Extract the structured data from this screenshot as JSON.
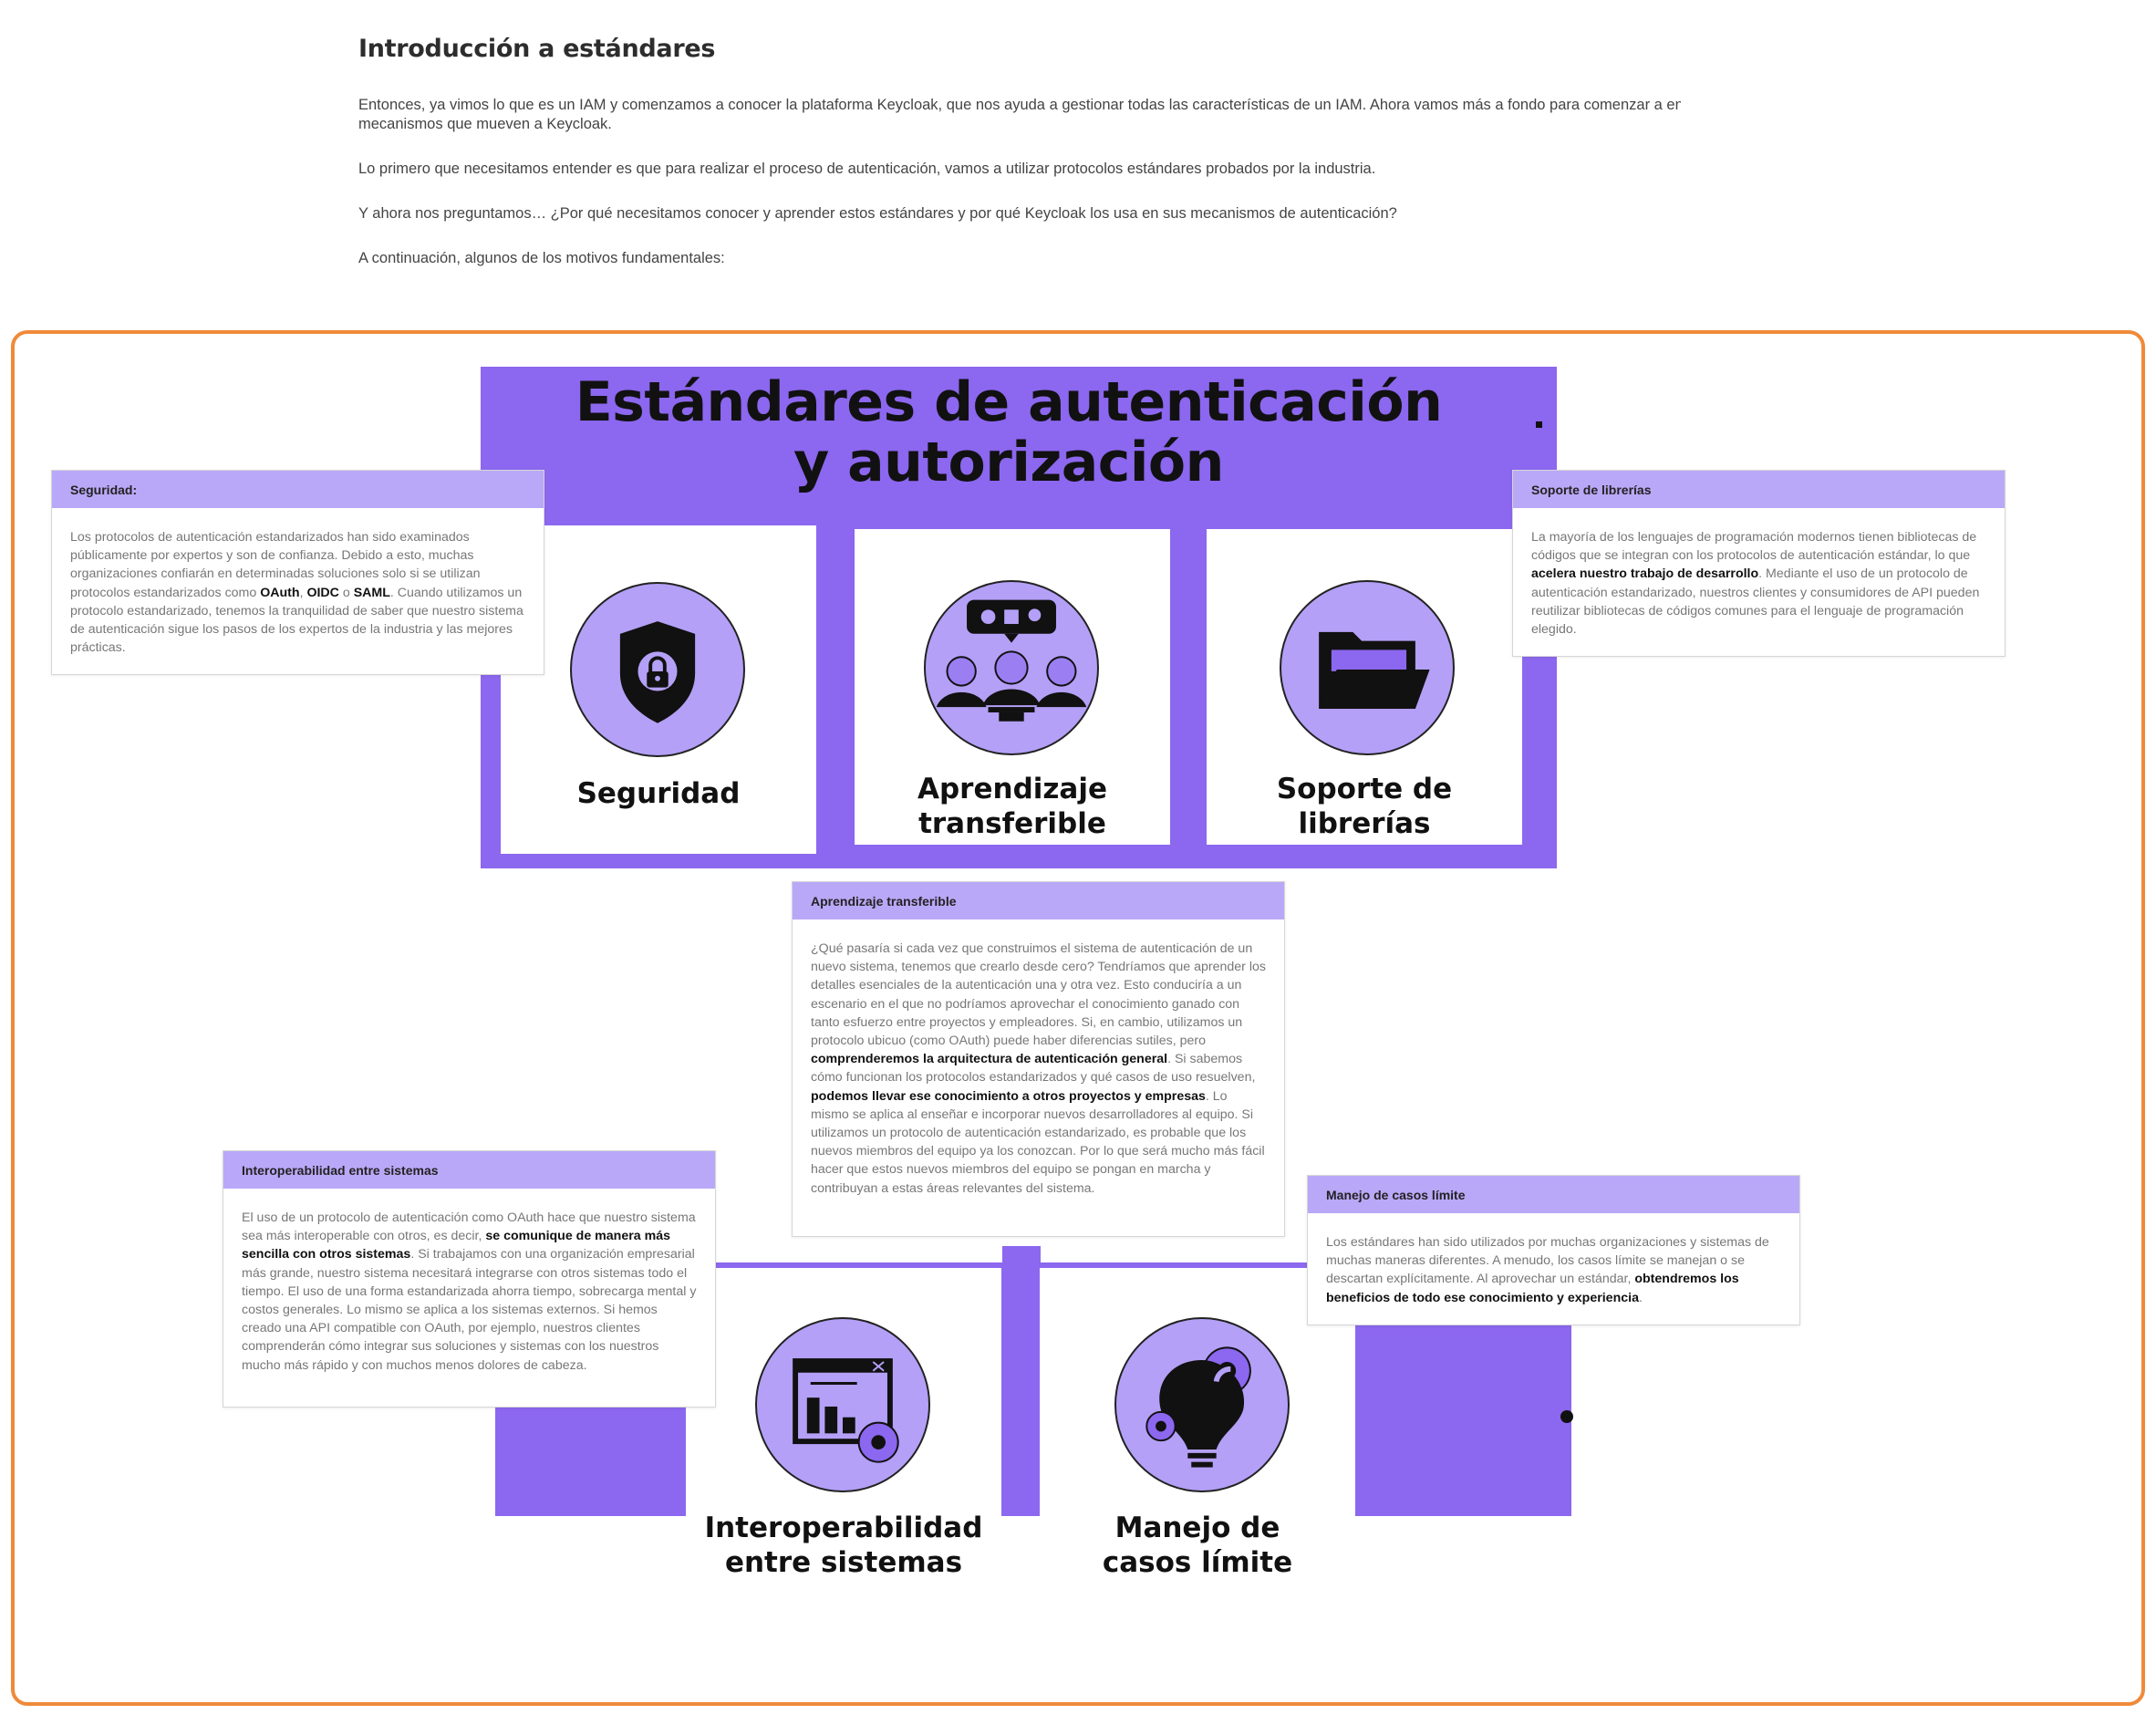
{
  "intro": {
    "heading": "Introducción a estándares",
    "p1": "Entonces, ya vimos lo que es un IAM y comenzamos a conocer la plataforma Keycloak, que nos ayuda a gestionar todas las características de un IAM. Ahora vamos más a fondo para comenzar a entender los",
    "p1b": "mecanismos que mueven a Keycloak.",
    "p2": "Lo primero que necesitamos entender es que para realizar el proceso de autenticación, vamos a utilizar protocolos estándares probados por la industria.",
    "p3": "Y ahora nos preguntamos… ¿Por qué necesitamos conocer y aprender estos estándares y por qué Keycloak los usa en sus mecanismos de autenticación?",
    "p4": "A continuación, algunos de los motivos fundamentales:"
  },
  "infographic": {
    "title_line1": "Estándares de autenticación",
    "title_line2": "y autorización",
    "cards": {
      "seguridad": "Seguridad",
      "aprendizaje_1": "Aprendizaje",
      "aprendizaje_2": "transferible",
      "soporte_1": "Soporte de",
      "soporte_2": "librerías",
      "interop_1": "Interoperabilidad",
      "interop_2": "entre sistemas",
      "manejo_1": "Manejo de",
      "manejo_2": "casos límite"
    },
    "icons": [
      "shield-lock-icon",
      "team-learning-icon",
      "folder-icon",
      "dashboard-gear-icon",
      "lightbulb-gears-icon"
    ],
    "colors": {
      "purple": "#8c67ef",
      "light_purple": "#b4a0f7",
      "header_purple": "#b9a8f7",
      "frame_orange": "#ef8a3a"
    }
  },
  "tooltips": {
    "seguridad": {
      "title": "Seguridad:",
      "t1": "Los protocolos de autenticación estandarizados han sido examinados públicamente por expertos y son de confianza. Debido a esto, muchas organizaciones confiarán en determinadas soluciones solo si se utilizan protocolos estandarizados como ",
      "b1": "OAuth",
      "t2": ", ",
      "b2": "OIDC",
      "t3": " o ",
      "b3": "SAML",
      "t4": ". Cuando utilizamos un protocolo estandarizado, tenemos la tranquilidad de saber que nuestro sistema de autenticación sigue los pasos de los expertos de la industria y las mejores prácticas."
    },
    "soporte": {
      "title": "Soporte de librerías",
      "t1": "La mayoría de los lenguajes de programación modernos tienen bibliotecas de códigos que se integran con los protocolos de autenticación estándar, lo que ",
      "b1": "acelera nuestro trabajo de desarrollo",
      "t2": ". Mediante el uso de un protocolo de autenticación estandarizado, nuestros clientes y consumidores de API pueden reutilizar bibliotecas de códigos comunes para el lenguaje de programación elegido."
    },
    "aprendizaje": {
      "title": "Aprendizaje transferible",
      "t1": "¿Qué pasaría si cada vez que construimos el sistema de autenticación de un nuevo sistema, tenemos que crearlo desde cero? Tendríamos que aprender los detalles esenciales de la autenticación una y otra vez. Esto conduciría a un escenario en el que no podríamos aprovechar el conocimiento ganado con tanto esfuerzo entre proyectos y empleadores. Si, en cambio, utilizamos un protocolo ubicuo (como OAuth) puede haber diferencias sutiles, pero ",
      "b1": "comprenderemos la arquitectura de autenticación general",
      "t2": ". Si sabemos cómo funcionan los protocolos estandarizados y qué casos de uso resuelven, ",
      "b2": "podemos llevar ese conocimiento a otros proyectos y empresas",
      "t3": ". Lo mismo se aplica al enseñar e incorporar nuevos desarrolladores al equipo. Si utilizamos un protocolo de autenticación estandarizado, es probable que los nuevos miembros del equipo ya los conozcan. Por lo que será mucho más fácil hacer que estos nuevos miembros del equipo se pongan en marcha y contribuyan a estas áreas relevantes del sistema."
    },
    "interop": {
      "title": "Interoperabilidad entre sistemas",
      "t1": "El uso de un protocolo de autenticación como OAuth hace que nuestro sistema sea más interoperable con otros, es decir, ",
      "b1": "se comunique de manera más sencilla con otros sistemas",
      "t2": ". Si trabajamos con una organización empresarial más grande, nuestro sistema necesitará integrarse con otros sistemas todo el tiempo. El uso de una forma estandarizada ahorra tiempo, sobrecarga mental y costos generales. Lo mismo se aplica a los sistemas externos. Si hemos creado una API compatible con OAuth, por ejemplo, nuestros clientes comprenderán cómo integrar sus soluciones y sistemas con los nuestros mucho más rápido y con muchos menos dolores de cabeza."
    },
    "manejo": {
      "title": "Manejo de casos límite",
      "t1": "Los estándares han sido utilizados por muchas organizaciones y sistemas de muchas maneras diferentes. A menudo, los casos límite se manejan o se descartan explícitamente. Al aprovechar un estándar, ",
      "b1": "obtendremos los beneficios de todo ese conocimiento y experiencia",
      "t2": "."
    }
  }
}
